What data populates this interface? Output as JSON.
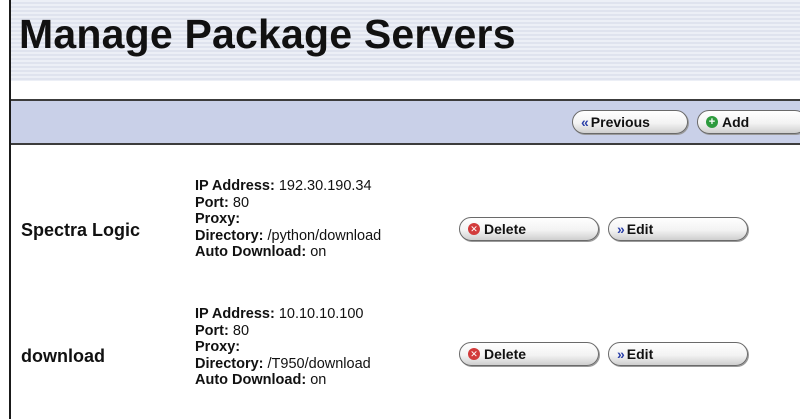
{
  "page": {
    "title": "Manage Package Servers"
  },
  "toolbar": {
    "previous_label": "Previous",
    "add_label": "Add"
  },
  "labels": {
    "ip": "IP Address:",
    "port": "Port:",
    "proxy": "Proxy:",
    "directory": "Directory:",
    "auto": "Auto Download:"
  },
  "servers": [
    {
      "name": "Spectra Logic",
      "ip": "192.30.190.34",
      "port": "80",
      "proxy": "",
      "directory": "/python/download",
      "auto_download": "on",
      "delete_label": "Delete",
      "edit_label": "Edit"
    },
    {
      "name": "download",
      "ip": "10.10.10.100",
      "port": "80",
      "proxy": "",
      "directory": "/T950/download",
      "auto_download": "on",
      "delete_label": "Delete",
      "edit_label": "Edit"
    }
  ],
  "icons": {
    "previous": "double-chevron-left-icon",
    "add": "plus-circle-icon",
    "delete": "x-circle-icon",
    "edit": "double-chevron-right-icon"
  },
  "colors": {
    "toolbar_bg": "#c9d0e8",
    "add_icon": "#2e9b3e",
    "delete_icon": "#d23a3a",
    "arrow_icon": "#2a3fa8"
  }
}
